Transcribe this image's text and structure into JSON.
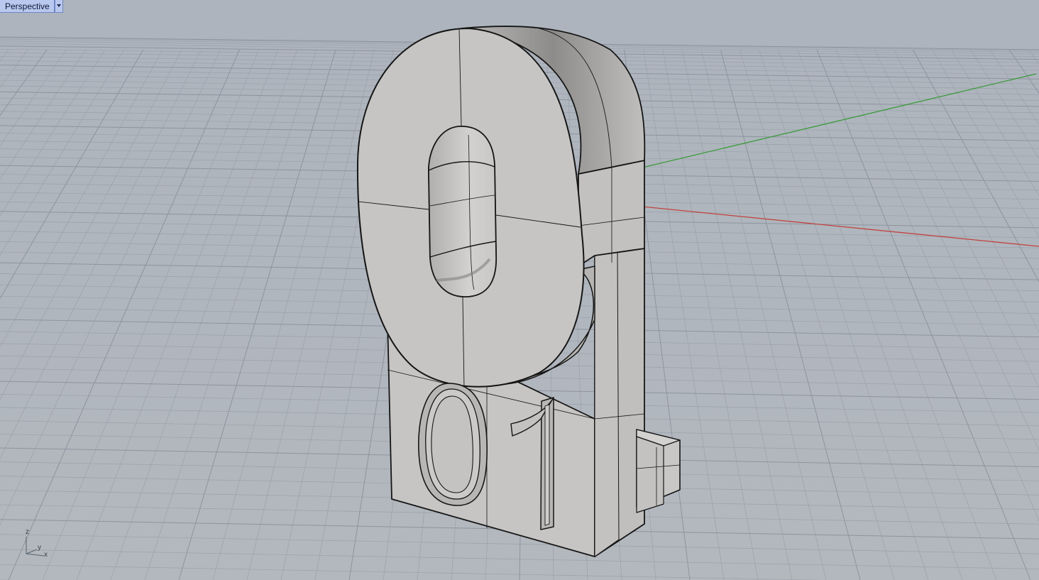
{
  "viewport": {
    "title": "Perspective",
    "dropdown_icon": "chevron-down-icon",
    "background": "#a9b0b9"
  },
  "axes_widget": {
    "z_label": "z",
    "y_label": "y",
    "x_label": "x"
  },
  "axis_colors": {
    "x_axis": "#c0443f",
    "y_axis": "#3c9a3c",
    "grid": "#98a0aa",
    "grid_major": "#8c939d"
  },
  "model": {
    "front_text": [
      "0",
      "1"
    ],
    "large_glyph": "0",
    "surface_color": "#c4c3c1",
    "edge_color": "#151515"
  }
}
